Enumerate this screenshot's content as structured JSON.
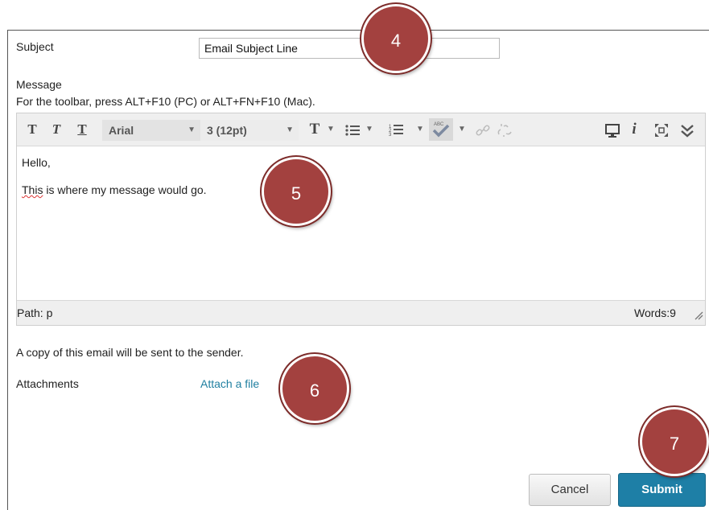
{
  "form": {
    "subject_label": "Subject",
    "subject_value": "Email Subject Line",
    "message_label": "Message",
    "toolbar_hint": "For the toolbar, press ALT+F10 (PC) or ALT+FN+F10 (Mac)."
  },
  "editor": {
    "toolbar": {
      "bold_glyph": "T",
      "italic_glyph": "T",
      "underline_glyph": "T",
      "font_family": "Arial",
      "font_size": "3 (12pt)",
      "text_color_glyph": "T",
      "more_glyph": "≫",
      "info_glyph": "i"
    },
    "content_lines": [
      "Hello,",
      "This",
      " is where my message would go."
    ],
    "path": "Path: p",
    "word_count": "Words:9"
  },
  "copy_note": "A copy of this email will be sent to the sender.",
  "attachments": {
    "label": "Attachments",
    "link": "Attach a file"
  },
  "buttons": {
    "cancel": "Cancel",
    "submit": "Submit"
  },
  "markers": [
    "4",
    "5",
    "6",
    "7"
  ],
  "colors": {
    "marker": "#a3413f",
    "submit": "#1e7fa6",
    "link": "#1f7fa0"
  },
  "icons": [
    "bold-icon",
    "italic-icon",
    "underline-icon",
    "text-color-icon",
    "bullet-list-icon",
    "numbered-list-icon",
    "spellcheck-icon",
    "link-icon",
    "unlink-icon",
    "preview-icon",
    "info-icon",
    "fullscreen-icon",
    "more-tools-icon",
    "resize-handle-icon"
  ]
}
